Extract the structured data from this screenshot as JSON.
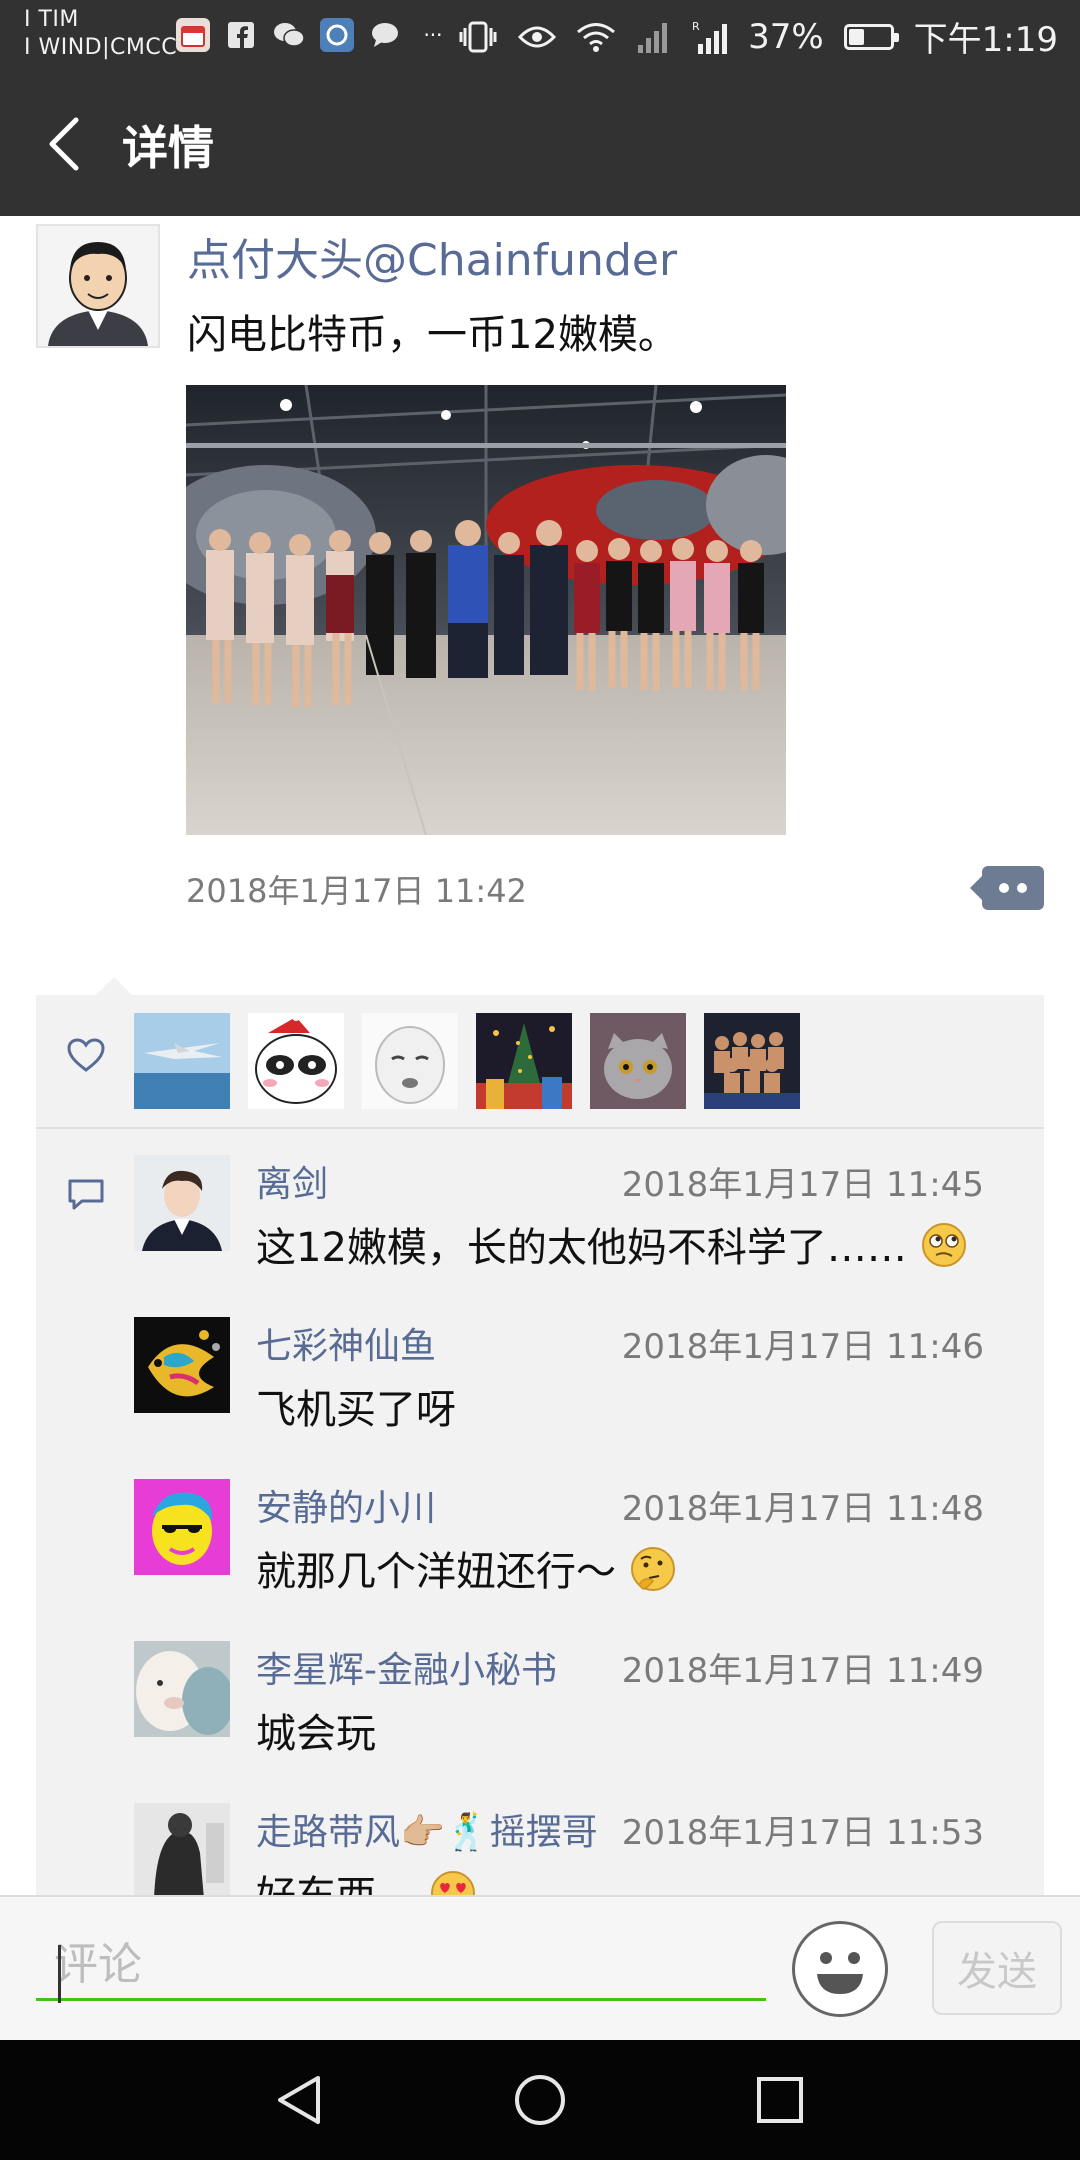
{
  "status_bar": {
    "carrier_1": "I TIM",
    "carrier_2": "I WIND|CMCC",
    "battery_percent": "37%",
    "battery_level": 0.37,
    "time": "下午1:19",
    "notification_icons": [
      "calendar-icon",
      "facebook-icon",
      "wechat-icon",
      "browser-icon",
      "message-icon",
      "more-icon"
    ],
    "system_icons": [
      "vibrate-icon",
      "eye-icon",
      "wifi-icon",
      "signal-icon",
      "roaming-signal-icon",
      "battery-icon"
    ],
    "more_label": "···"
  },
  "title_bar": {
    "title": "详情"
  },
  "post": {
    "author": "点付大头@Chainfunder",
    "content": "闪电比特币，一币12嫩模。",
    "time": "2018年1月17日 11:42"
  },
  "likes": {
    "avatars": [
      "aircraft-avatar",
      "panda-avatar",
      "meme-face-avatar",
      "crowd-avatar",
      "cat-avatar",
      "group-avatar"
    ]
  },
  "comments": [
    {
      "name": "离剑",
      "time": "2018年1月17日 11:45",
      "text": "这12嫩模，长的太他妈不科学了……",
      "emoji": "thinking-eyes"
    },
    {
      "name": "七彩神仙鱼",
      "time": "2018年1月17日 11:46",
      "text": "飞机买了呀",
      "emoji": ""
    },
    {
      "name": "安静的小川",
      "time": "2018年1月17日 11:48",
      "text": "就那几个洋妞还行～",
      "emoji": "thinking"
    },
    {
      "name": "李星辉-金融小秘书",
      "time": "2018年1月17日 11:49",
      "text": "城会玩",
      "emoji": ""
    },
    {
      "name": "走路带风👉🏼🕺摇摆哥",
      "time": "2018年1月17日 11:53",
      "text": "好东西…",
      "emoji": "heart-eyes"
    }
  ],
  "input_bar": {
    "placeholder": "评论",
    "send_label": "发送"
  },
  "colors": {
    "header_bg": "#323232",
    "link_blue": "#576b95",
    "panel_bg": "#f2f2f2",
    "input_underline": "#45c01a"
  }
}
